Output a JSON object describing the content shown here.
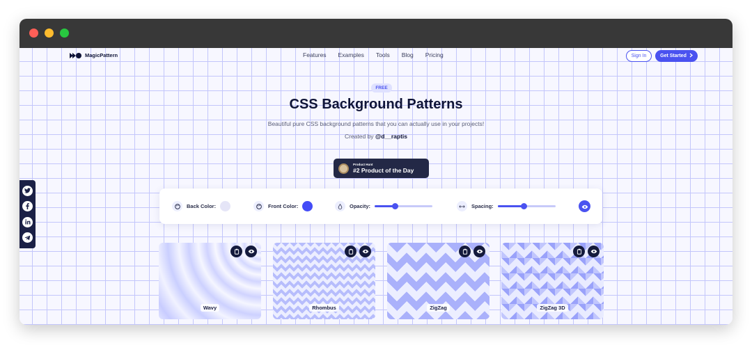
{
  "nav": {
    "brand": "MagicPattern",
    "links": [
      "Features",
      "Examples",
      "Tools",
      "Blog",
      "Pricing"
    ],
    "sign_in": "Sign In",
    "get_started": "Get Started"
  },
  "hero": {
    "badge": "FREE",
    "title": "CSS Background Patterns",
    "subtitle": "Beautiful pure CSS background patterns that you can actually use in your projects!",
    "credit_prefix": "Created by",
    "credit_handle": "@d__raptis"
  },
  "product_hunt": {
    "small": "Product Hunt",
    "big": "#2 Product of the Day"
  },
  "social": {
    "icons": [
      "twitter-icon",
      "facebook-icon",
      "linkedin-icon",
      "telegram-icon"
    ]
  },
  "controls": {
    "back_color_label": "Back Color:",
    "front_color_label": "Front Color:",
    "opacity_label": "Opacity:",
    "spacing_label": "Spacing:",
    "back_color": "#e5e5f7",
    "front_color": "#444cf7",
    "opacity_level": 0.35,
    "spacing_level": 0.45
  },
  "patterns": [
    {
      "label": "Wavy"
    },
    {
      "label": "Rhombus"
    },
    {
      "label": "ZigZag"
    },
    {
      "label": "ZigZag 3D"
    }
  ],
  "colors": {
    "accent": "#4a52f0",
    "dark": "#0f1437"
  }
}
